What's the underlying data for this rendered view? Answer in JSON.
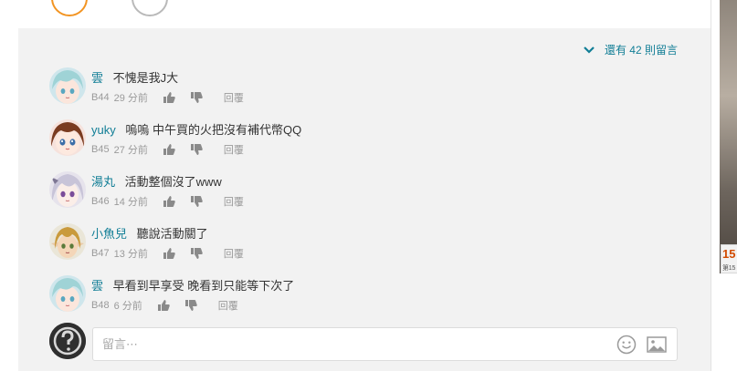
{
  "comments": {
    "more": {
      "label": "還有 42 則留言"
    },
    "items": [
      {
        "name": "雲",
        "text": "不愧是我J大",
        "floor": "B44",
        "time": "29 分前",
        "reply": "回覆",
        "avatar": "avatar-teal-hair"
      },
      {
        "name": "yuky",
        "text": "嗚嗚 中午買的火把沒有補代幣QQ",
        "floor": "B45",
        "time": "27 分前",
        "reply": "回覆",
        "avatar": "avatar-brown-hair"
      },
      {
        "name": "湯丸",
        "text": "活動整個沒了www",
        "floor": "B46",
        "time": "14 分前",
        "reply": "回覆",
        "avatar": "avatar-silver-hair"
      },
      {
        "name": "小魚兒",
        "text": "聽說活動關了",
        "floor": "B47",
        "time": "13 分前",
        "reply": "回覆",
        "avatar": "avatar-elf"
      },
      {
        "name": "雲",
        "text": "早看到早享受 晚看到只能等下次了",
        "floor": "B48",
        "time": "6 分前",
        "reply": "回覆",
        "avatar": "avatar-teal-hair"
      }
    ]
  },
  "reply_box": {
    "placeholder": "留言⋯",
    "value": ""
  },
  "side_thumbnail": {
    "number": "15",
    "caption": "第15"
  },
  "icons": {
    "expand": "chevron-down-icon",
    "like": "thumbs-up-icon",
    "dislike": "thumbs-down-icon",
    "emoji": "smile-icon",
    "image": "image-icon",
    "unknown_user": "question-mark-avatar"
  },
  "colors": {
    "link": "#117e96",
    "meta": "#9a9a9a",
    "panel": "#f2f2f2",
    "accent_orange": "#f29422"
  }
}
